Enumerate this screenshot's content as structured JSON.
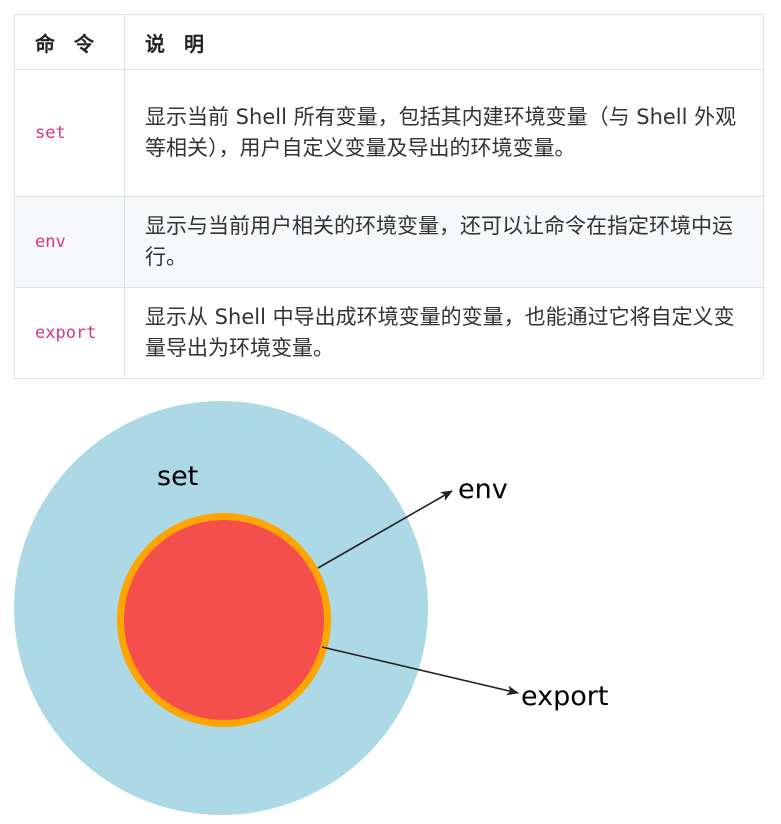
{
  "table": {
    "headers": [
      "命 令",
      "说 明"
    ],
    "rows": [
      {
        "command": "set",
        "description": "显示当前 Shell 所有变量，包括其内建环境变量（与 Shell 外观等相关），用户自定义变量及导出的环境变量。"
      },
      {
        "command": "env",
        "description": "显示与当前用户相关的环境变量，还可以让命令在指定环境中运行。"
      },
      {
        "command": "export",
        "description": "显示从 Shell 中导出成环境变量的变量，也能通过它将自定义变量导出为环境变量。"
      }
    ]
  },
  "diagram": {
    "outer_label": "set",
    "arrow_labels": [
      "env",
      "export"
    ],
    "colors": {
      "outer_circle": "#add8e6",
      "inner_ring": "#ffa500",
      "inner_circle": "#f44f4d",
      "arrow": "#222222"
    }
  }
}
